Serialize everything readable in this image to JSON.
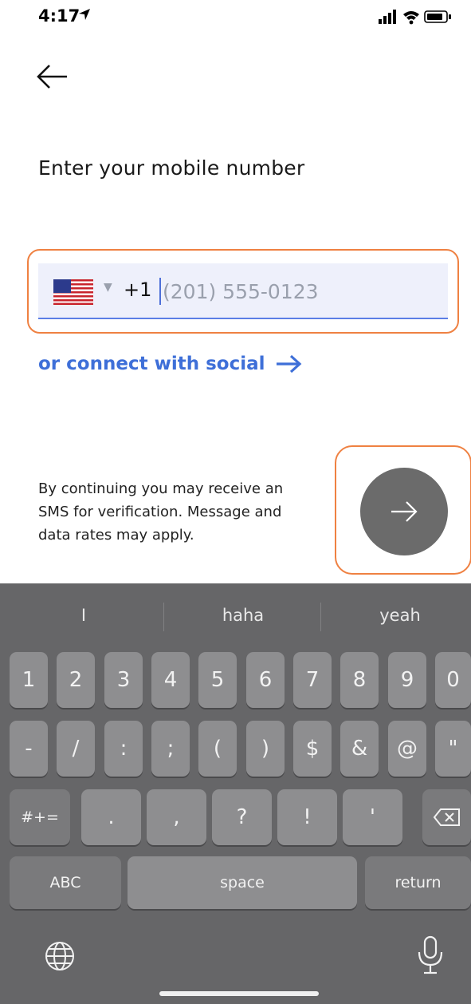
{
  "status_bar": {
    "time": "4:17"
  },
  "title": "Enter your mobile number",
  "phone": {
    "dial_code": "+1",
    "placeholder": "(201) 555-0123",
    "value": ""
  },
  "social_link": "or connect with social",
  "disclaimer": "By continuing you may receive an SMS for verification. Message and data rates may apply.",
  "keyboard": {
    "suggestions": [
      "I",
      "haha",
      "yeah"
    ],
    "row1": [
      "1",
      "2",
      "3",
      "4",
      "5",
      "6",
      "7",
      "8",
      "9",
      "0"
    ],
    "row2": [
      "-",
      "/",
      ":",
      ";",
      "(",
      ")",
      "$",
      "&",
      "@",
      "\""
    ],
    "row3_mode": "#+=",
    "row3": [
      ".",
      ",",
      "?",
      "!",
      "'"
    ],
    "abc": "ABC",
    "space": "space",
    "return": "return"
  },
  "colors": {
    "accent": "#3e6fd8",
    "highlight": "#ef8142",
    "keyboard_bg": "#666668",
    "field_bg": "#eef0fb"
  }
}
